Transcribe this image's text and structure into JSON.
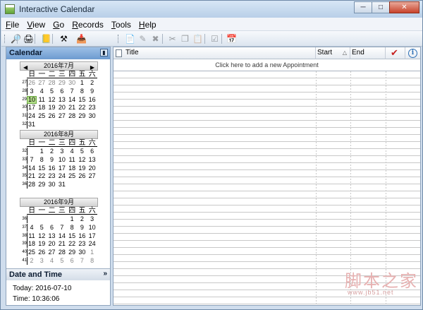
{
  "window": {
    "title": "Interactive Calendar",
    "buttons": {
      "minimize": "─",
      "maximize": "□",
      "close": "✕"
    }
  },
  "menu": [
    "File",
    "View",
    "Go",
    "Records",
    "Tools",
    "Help"
  ],
  "menu_underline": [
    "F",
    "V",
    "G",
    "R",
    "T",
    "H"
  ],
  "toolbar_left": [
    {
      "name": "search-icon",
      "glyph": "🔎"
    },
    {
      "name": "print-icon",
      "glyph": "🖨"
    },
    {
      "name": "address-book-icon",
      "glyph": "📒"
    },
    {
      "name": "tools-icon",
      "glyph": "⚒"
    },
    {
      "name": "import-icon",
      "glyph": "📥"
    }
  ],
  "toolbar_right": [
    {
      "name": "new-record-icon",
      "glyph": "📄",
      "enabled": true
    },
    {
      "name": "edit-record-icon",
      "glyph": "✎",
      "enabled": false
    },
    {
      "name": "delete-record-icon",
      "glyph": "✖",
      "enabled": false
    },
    {
      "name": "cut-icon",
      "glyph": "✂",
      "enabled": false
    },
    {
      "name": "copy-icon",
      "glyph": "❐",
      "enabled": false
    },
    {
      "name": "paste-icon",
      "glyph": "📋",
      "enabled": false
    },
    {
      "name": "properties-icon",
      "glyph": "☑",
      "enabled": false
    },
    {
      "name": "calendar-view-icon",
      "glyph": "📅",
      "enabled": true
    }
  ],
  "left_pane": {
    "header": "Calendar",
    "weekdays": [
      "日",
      "一",
      "二",
      "三",
      "四",
      "五",
      "六"
    ],
    "months": [
      {
        "title": "2016年7月",
        "weeks": [
          {
            "wk": "27",
            "days": [
              "26",
              "27",
              "28",
              "29",
              "30",
              "1",
              "2"
            ],
            "other": [
              0,
              1,
              2,
              3,
              4
            ]
          },
          {
            "wk": "28",
            "days": [
              "3",
              "4",
              "5",
              "6",
              "7",
              "8",
              "9"
            ],
            "other": []
          },
          {
            "wk": "29",
            "days": [
              "10",
              "11",
              "12",
              "13",
              "14",
              "15",
              "16"
            ],
            "other": []
          },
          {
            "wk": "30",
            "days": [
              "17",
              "18",
              "19",
              "20",
              "21",
              "22",
              "23"
            ],
            "other": []
          },
          {
            "wk": "31",
            "days": [
              "24",
              "25",
              "26",
              "27",
              "28",
              "29",
              "30"
            ],
            "other": []
          },
          {
            "wk": "32",
            "days": [
              "31",
              "",
              "",
              "",
              "",
              "",
              ""
            ],
            "other": []
          }
        ],
        "today_day": "10",
        "show_nav": true
      },
      {
        "title": "2016年8月",
        "weeks": [
          {
            "wk": "32",
            "days": [
              "",
              "1",
              "2",
              "3",
              "4",
              "5",
              "6"
            ],
            "other": []
          },
          {
            "wk": "33",
            "days": [
              "7",
              "8",
              "9",
              "10",
              "11",
              "12",
              "13"
            ],
            "other": []
          },
          {
            "wk": "34",
            "days": [
              "14",
              "15",
              "16",
              "17",
              "18",
              "19",
              "20"
            ],
            "other": []
          },
          {
            "wk": "35",
            "days": [
              "21",
              "22",
              "23",
              "24",
              "25",
              "26",
              "27"
            ],
            "other": []
          },
          {
            "wk": "36",
            "days": [
              "28",
              "29",
              "30",
              "31",
              "",
              "",
              ""
            ],
            "other": []
          }
        ],
        "today_day": "",
        "show_nav": false
      },
      {
        "title": "2016年9月",
        "weeks": [
          {
            "wk": "36",
            "days": [
              "",
              "",
              "",
              "",
              "1",
              "2",
              "3"
            ],
            "other": []
          },
          {
            "wk": "37",
            "days": [
              "4",
              "5",
              "6",
              "7",
              "8",
              "9",
              "10"
            ],
            "other": []
          },
          {
            "wk": "38",
            "days": [
              "11",
              "12",
              "13",
              "14",
              "15",
              "16",
              "17"
            ],
            "other": []
          },
          {
            "wk": "39",
            "days": [
              "18",
              "19",
              "20",
              "21",
              "22",
              "23",
              "24"
            ],
            "other": []
          },
          {
            "wk": "40",
            "days": [
              "25",
              "26",
              "27",
              "28",
              "29",
              "30",
              "1"
            ],
            "other": [
              6
            ]
          },
          {
            "wk": "41",
            "days": [
              "2",
              "3",
              "4",
              "5",
              "6",
              "7",
              "8"
            ],
            "other": [
              0,
              1,
              2,
              3,
              4,
              5,
              6
            ]
          }
        ],
        "today_day": "",
        "show_nav": false
      }
    ],
    "date_time_header": "Date and Time",
    "today_text": "Today: 2016-07-10",
    "time_text": "Time: 10:36:06"
  },
  "right_pane": {
    "columns": {
      "title": "Title",
      "start": "Start",
      "end": "End"
    },
    "add_row_text": "Click here to add a new Appointment"
  },
  "watermark": {
    "text": "脚本之家",
    "sub": "www.jb51.net"
  },
  "colors": {
    "accent": "#6d9bd0",
    "today": "#b5e08c",
    "check": "#c62020"
  }
}
